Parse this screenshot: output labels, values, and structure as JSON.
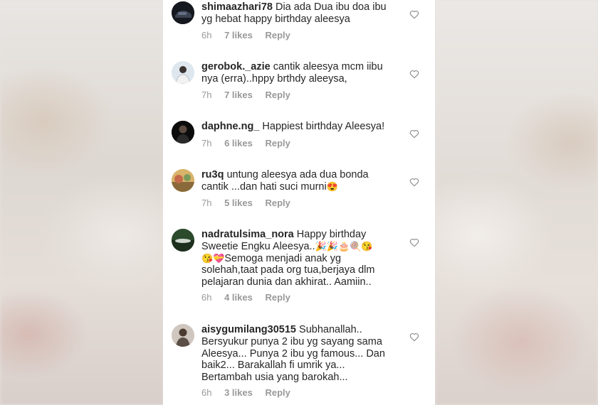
{
  "comments": [
    {
      "username": "shimaazhari78",
      "text": "Dia ada Dua ibu doa ibu yg hebat happy birthday aleesya",
      "time": "6h",
      "likes": "7 likes",
      "reply": "Reply",
      "avatar_icon": "dark-car-avatar-icon"
    },
    {
      "username": "gerobok._azie",
      "text": "cantik aleesya mcm iibu nya (erra)..hppy brthdy aleeysa,",
      "time": "7h",
      "likes": "7 likes",
      "reply": "Reply",
      "avatar_icon": "person-avatar-icon"
    },
    {
      "username": "daphne.ng_",
      "text": "Happiest birthday Aleesya!",
      "time": "7h",
      "likes": "6 likes",
      "reply": "Reply",
      "avatar_icon": "dark-portrait-avatar-icon"
    },
    {
      "username": "ru3q",
      "text": "untung aleesya ada dua bonda cantik ...dan hati suci murni",
      "emoji": "😍",
      "time": "7h",
      "likes": "5 likes",
      "reply": "Reply",
      "avatar_icon": "landscape-avatar-icon"
    },
    {
      "username": "nadratulsima_nora",
      "text_1": "Happy birthday Sweetie Engku Aleesya..",
      "emoji_1": "🎉🎉🎂🍭😘",
      "emoji_2": "😘💝",
      "text_2": "Semoga menjadi anak yg solehah,taat pada org tua,berjaya dlm pelajaran dunia dan akhirat.. Aamiin..",
      "time": "6h",
      "likes": "4 likes",
      "reply": "Reply",
      "avatar_icon": "nature-avatar-icon"
    },
    {
      "username": "aisygumilang30515",
      "text": "Subhanallah.. Bersyukur punya 2 ibu yg sayang sama Aleesya... Punya 2 ibu yg famous... Dan baik2... Barakallah fi umrik ya... Bertambah usia yang barokah...",
      "time": "6h",
      "likes": "3 likes",
      "reply": "Reply",
      "avatar_icon": "person-avatar-icon"
    }
  ],
  "colors": {
    "text": "#262626",
    "meta": "#999999",
    "panel": "#ffffff"
  }
}
